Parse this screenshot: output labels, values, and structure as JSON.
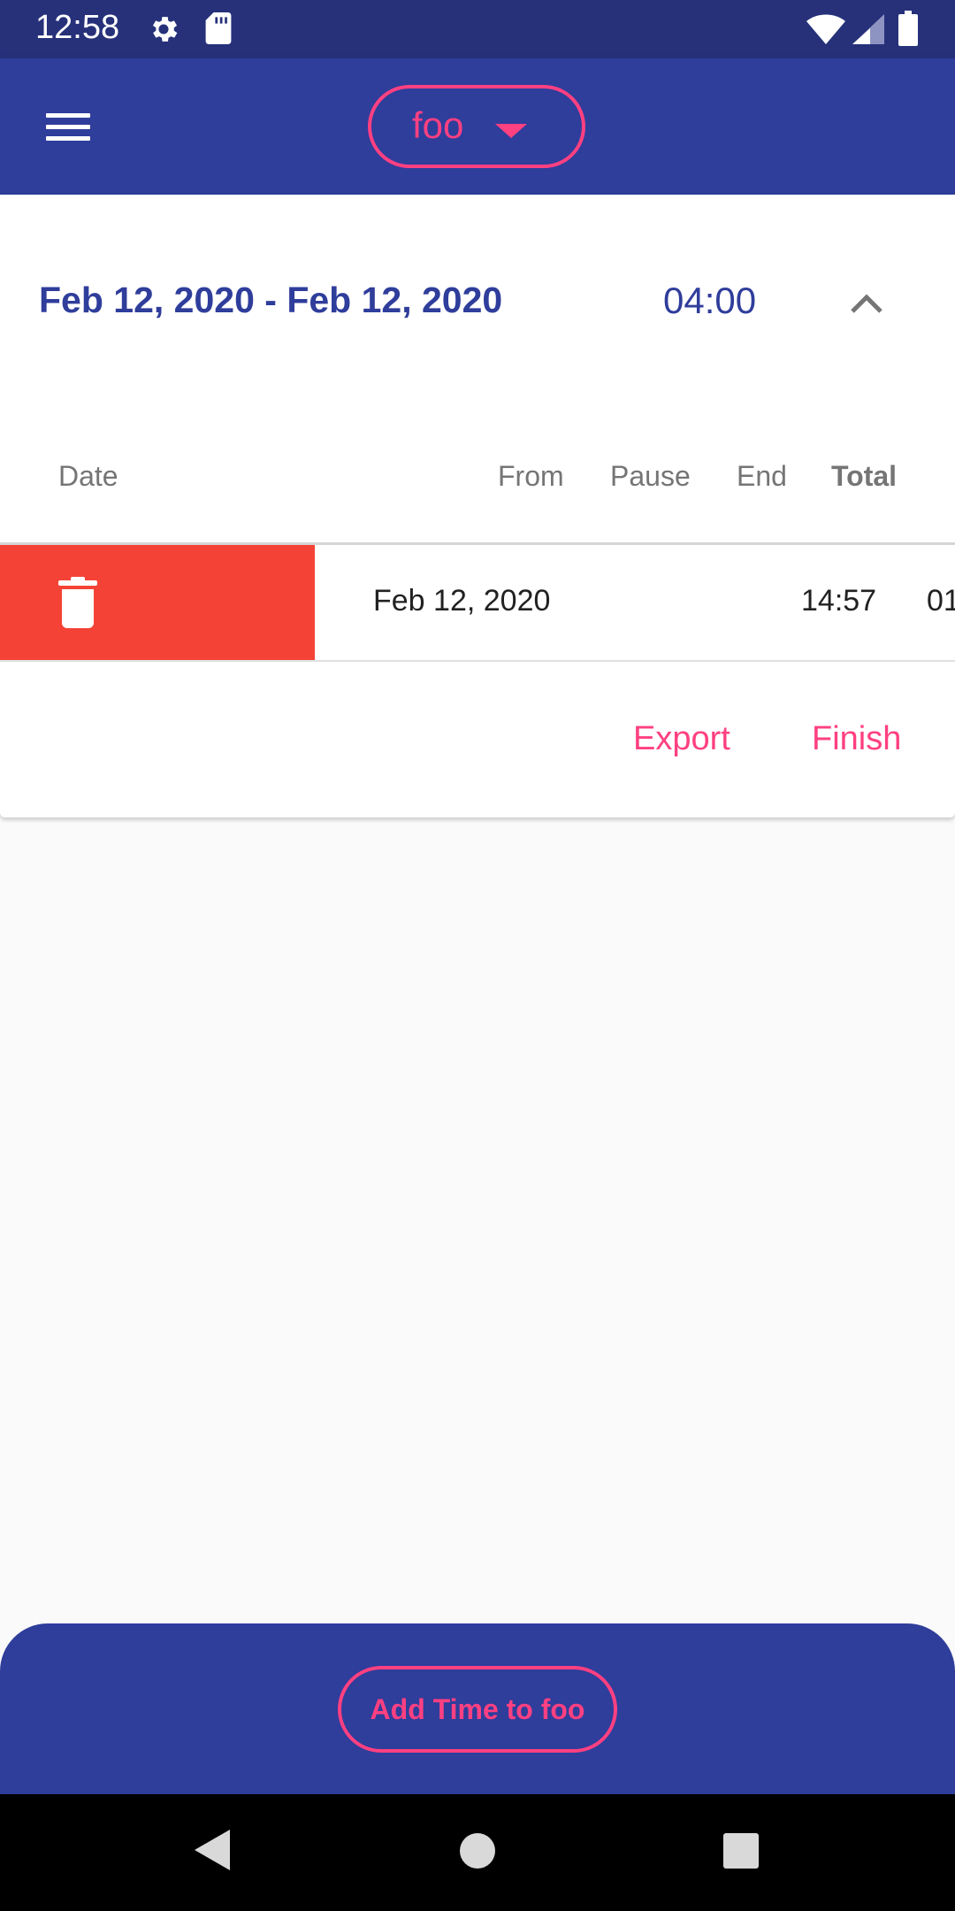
{
  "status_bar": {
    "time": "12:58",
    "icons": [
      "gear-icon",
      "sdcard-icon",
      "wifi-icon",
      "signal-icon",
      "battery-icon"
    ]
  },
  "app_bar": {
    "menu_icon": "menu-icon",
    "project": "foo",
    "project_dropdown_icon": "caret-down-icon"
  },
  "summary": {
    "range": "Feb 12, 2020 - Feb 12, 2020",
    "total": "04:00",
    "collapse_icon": "chevron-up-icon"
  },
  "table": {
    "columns": [
      "Date",
      "From",
      "Pause",
      "End",
      "Total"
    ],
    "rows": [
      {
        "date": "Feb 12, 2020",
        "from": "14:57",
        "pause": "01",
        "delete_icon": "trash-icon"
      }
    ]
  },
  "actions": {
    "export": "Export",
    "finish": "Finish"
  },
  "bottom": {
    "add_time": "Add Time to foo"
  },
  "nav": [
    "back-icon",
    "home-icon",
    "recents-icon"
  ],
  "colors": {
    "primary": "#2f3d9b",
    "status_bar": "#26317a",
    "accent": "#ff4081",
    "delete": "#f44336"
  }
}
